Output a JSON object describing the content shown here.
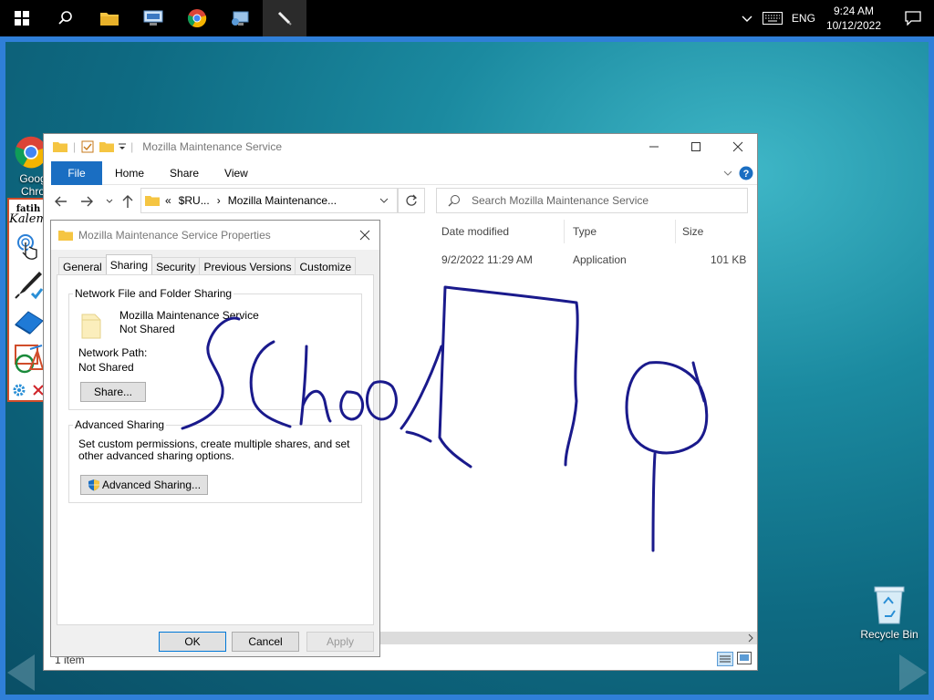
{
  "taskbar": {
    "apps": [
      "start-icon",
      "search-icon",
      "file-explorer-icon",
      "network-icon",
      "chrome-icon",
      "remote-icon",
      "kalem-pen-icon"
    ],
    "language": "ENG",
    "time": "9:24 AM",
    "date": "10/12/2022"
  },
  "desktop": {
    "icons": [
      {
        "label": "Goog\nChro"
      },
      {
        "label": "Recycle Bin"
      }
    ]
  },
  "kalem": {
    "title_top": "fatih",
    "title_bottom": "Kalem"
  },
  "explorer": {
    "title": "Mozilla Maintenance Service",
    "ribbon": {
      "file": "File",
      "home": "Home",
      "share": "Share",
      "view": "View"
    },
    "address": {
      "prefix": "«",
      "crumb1": "$RU...",
      "sep": "›",
      "crumb2": "Mozilla Maintenance..."
    },
    "search_placeholder": "Search Mozilla Maintenance Service",
    "columns": {
      "date": "Date modified",
      "type": "Type",
      "size": "Size"
    },
    "row": {
      "date": "9/2/2022 11:29 AM",
      "type": "Application",
      "size": "101 KB"
    },
    "status": "1 item"
  },
  "dialog": {
    "title": "Mozilla Maintenance Service Properties",
    "tabs": [
      "General",
      "Sharing",
      "Security",
      "Previous Versions",
      "Customize"
    ],
    "network_group": "Network File and Folder Sharing",
    "folder_name": "Mozilla Maintenance Service",
    "folder_state": "Not Shared",
    "network_path_label": "Network Path:",
    "network_path_value": "Not Shared",
    "share_btn": "Share...",
    "advanced_group": "Advanced Sharing",
    "advanced_desc": "Set custom permissions, create multiple shares, and set other advanced sharing options.",
    "advanced_btn": "Advanced Sharing...",
    "ok": "OK",
    "cancel": "Cancel",
    "apply": "Apply"
  },
  "colors": {
    "accent": "#1a6ec2",
    "frame": "#2f7fd8",
    "ink": "#1a1a8c",
    "kalem_border": "#d04c2a"
  }
}
